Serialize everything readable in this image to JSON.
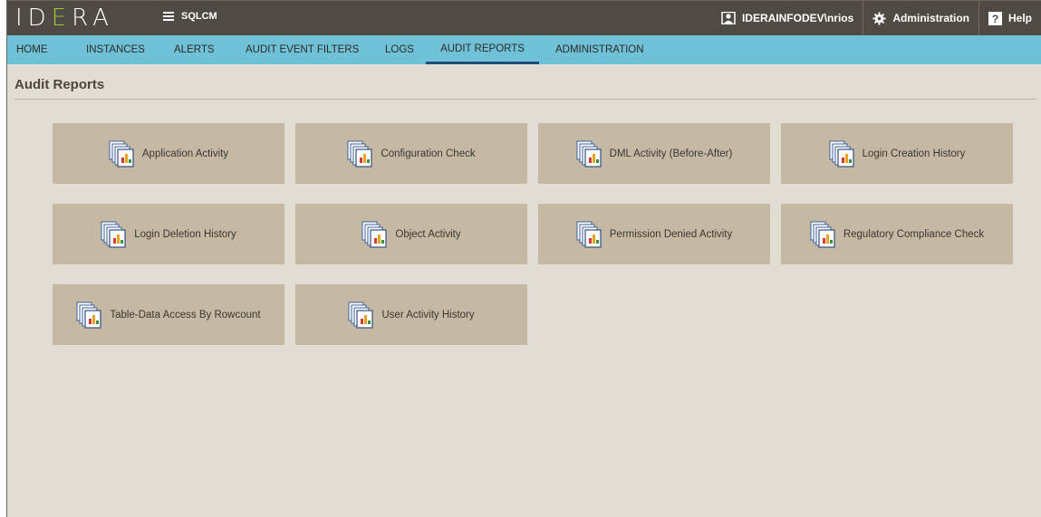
{
  "brand": {
    "logo_text_1": "ID",
    "logo_text_2": "E",
    "logo_text_3": "RA",
    "product": "SQLCM"
  },
  "topbar": {
    "user": "IDERAINFODEV\\nrios",
    "administration": "Administration",
    "help": "Help"
  },
  "nav": {
    "items": [
      {
        "label": "HOME"
      },
      {
        "label": "INSTANCES"
      },
      {
        "label": "ALERTS"
      },
      {
        "label": "AUDIT EVENT FILTERS"
      },
      {
        "label": "LOGS"
      },
      {
        "label": "AUDIT REPORTS"
      },
      {
        "label": "ADMINISTRATION"
      }
    ],
    "active": "AUDIT REPORTS"
  },
  "page": {
    "title": "Audit Reports"
  },
  "reports": [
    {
      "label": "Application Activity"
    },
    {
      "label": "Configuration Check"
    },
    {
      "label": "DML Activity (Before-After)"
    },
    {
      "label": "Login Creation History"
    },
    {
      "label": "Login Deletion History"
    },
    {
      "label": "Object Activity"
    },
    {
      "label": "Permission Denied Activity"
    },
    {
      "label": "Regulatory Compliance Check"
    },
    {
      "label": "Table-Data Access By Rowcount"
    },
    {
      "label": "User Activity History"
    }
  ],
  "colors": {
    "topbar": "#4f4a44",
    "navbar": "#6fc1d7",
    "background": "#e2ddd3",
    "tile": "#c6b9a4",
    "active_underline": "#1d4f75",
    "logo_accent": "#9cc83a"
  }
}
